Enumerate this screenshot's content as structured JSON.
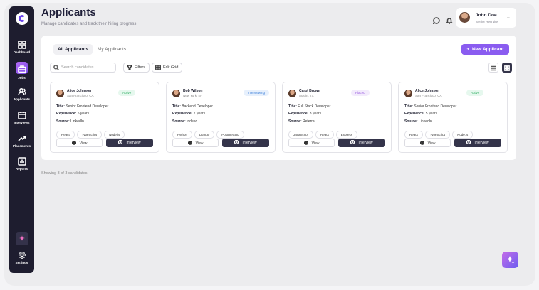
{
  "header": {
    "title": "Applicants",
    "subtitle": "Manage candidates and track their hiring progress"
  },
  "user": {
    "name": "John Doe",
    "role": "Senior Recruiter"
  },
  "sidebar": {
    "items": [
      {
        "label": "Dashboard",
        "icon": "dashboard-icon"
      },
      {
        "label": "Jobs",
        "icon": "briefcase-icon",
        "active": true
      },
      {
        "label": "Applicants",
        "icon": "users-icon"
      },
      {
        "label": "Interviews",
        "icon": "calendar-icon"
      },
      {
        "label": "Placements",
        "icon": "trending-icon"
      },
      {
        "label": "Reports",
        "icon": "bar-chart-icon"
      }
    ],
    "settings_label": "Settings"
  },
  "tabs": [
    {
      "label": "All Applicants",
      "active": true
    },
    {
      "label": "My Applicants",
      "active": false
    }
  ],
  "new_button_label": "New Applicant",
  "search": {
    "placeholder": "Search candidates..."
  },
  "toolbar": {
    "filters_label": "Filters",
    "edit_grid_label": "Edit Grid"
  },
  "labels": {
    "title": "Title:",
    "experience": "Experience:",
    "source": "Source:",
    "view": "View",
    "interview": "Interview"
  },
  "cards": [
    {
      "name": "Alice Johnson",
      "location": "San Francisco, CA",
      "status": "Active",
      "status_color": "#e6f8ee",
      "status_text": "#2fae62",
      "title": "Senior Frontend Developer",
      "experience": "5 years",
      "source": "LinkedIn",
      "skills": [
        "React",
        "TypeScript",
        "Node.js"
      ]
    },
    {
      "name": "Bob Wilson",
      "location": "New York, NY",
      "status": "Interviewing",
      "status_color": "#e7f0fc",
      "status_text": "#3b7fd9",
      "title": "Backend Developer",
      "experience": "7 years",
      "source": "Indeed",
      "skills": [
        "Python",
        "Django",
        "PostgreSQL"
      ]
    },
    {
      "name": "Carol Brown",
      "location": "Austin, TX",
      "status": "Placed",
      "status_color": "#f3ebfc",
      "status_text": "#9a5ee0",
      "title": "Full Stack Developer",
      "experience": "3 years",
      "source": "Referral",
      "skills": [
        "JavaScript",
        "React",
        "Express"
      ]
    },
    {
      "name": "Alice Johnson",
      "location": "San Francisco, CA",
      "status": "Active",
      "status_color": "#e6f8ee",
      "status_text": "#2fae62",
      "title": "Senior Frontend Developer",
      "experience": "5 years",
      "source": "LinkedIn",
      "skills": [
        "React",
        "TypeScript",
        "Node.js"
      ]
    }
  ],
  "footer_text": "Showing 3 of 3 candidates",
  "colors": {
    "accent": "#8a5cf0",
    "sidebar": "#1e1d2f",
    "dark_button": "#34344a"
  }
}
